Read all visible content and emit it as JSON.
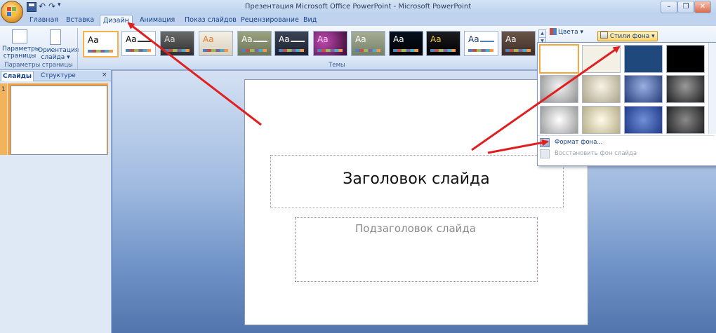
{
  "window": {
    "title": "Презентация Microsoft Office PowerPoint - Microsoft PowerPoint"
  },
  "window_controls": {
    "minimize": "–",
    "restore": "❐",
    "close": "✕"
  },
  "qat": {
    "undo": "↶",
    "redo": "↷",
    "more": "▾"
  },
  "tabs": [
    {
      "label": "Главная"
    },
    {
      "label": "Вставка"
    },
    {
      "label": "Дизайн",
      "active": true
    },
    {
      "label": "Анимация"
    },
    {
      "label": "Показ слайдов"
    },
    {
      "label": "Рецензирование"
    },
    {
      "label": "Вид"
    }
  ],
  "ribbon": {
    "page_setup": {
      "params_label": "Параметры страницы",
      "orientation_label": "Ориентация слайда ▾",
      "group_label": "Параметры страницы"
    },
    "themes": {
      "group_label": "Темы",
      "sample_text": "Aa",
      "scroll_up": "▲",
      "scroll_down": "▼"
    },
    "colors_label": "Цвета ▾",
    "background_styles_label": "Стили фона ▾"
  },
  "left_pane": {
    "tab_slides": "Слайды",
    "tab_outline": "Структуре",
    "close": "×",
    "slide_number": "1"
  },
  "slide": {
    "title": "Заголовок слайда",
    "subtitle": "Подзаголовок слайда"
  },
  "dropdown": {
    "format_background": "Формат фона...",
    "reset_background": "Восстановить фон слайда"
  },
  "colors": {
    "accent_arrow": "#e02020",
    "ribbon_text": "#15428b",
    "selection": "#f4a83a"
  }
}
